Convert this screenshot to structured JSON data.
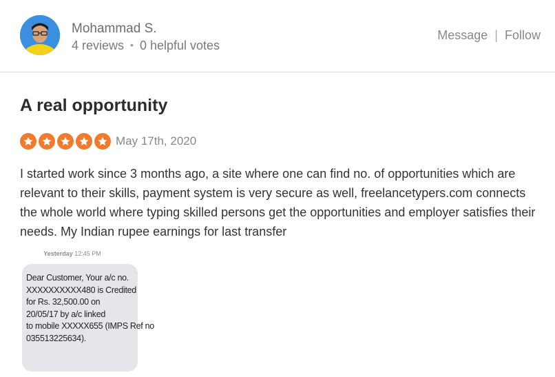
{
  "user": {
    "name": "Mohammad S.",
    "reviews": "4 reviews",
    "helpful_votes": "0 helpful votes"
  },
  "actions": {
    "message": "Message",
    "separator": "|",
    "follow": "Follow"
  },
  "review": {
    "title": "A real opportunity",
    "rating": 5,
    "rating_max": 5,
    "star_color": "#f07b2e",
    "date": "May 17th, 2020",
    "body": "I started work since 3 months ago, a site where one can find no. of opportunities which are relevant to their skills, payment system is very secure as well, freelancetypers.com connects the whole world where typing skilled persons get the opportunities and employer satisfies their needs. My Indian rupee earnings for last transfer"
  },
  "sms": {
    "day": "Yesterday",
    "time": "12:45 PM",
    "lines": [
      "Dear Customer, Your a/c no.",
      "XXXXXXXXXX480 is Credited",
      "for Rs. 32,500.00 on",
      "20/05/17 by a/c linked",
      "to mobile XXXXX655 (IMPS Ref no",
      "035513225634)."
    ]
  }
}
